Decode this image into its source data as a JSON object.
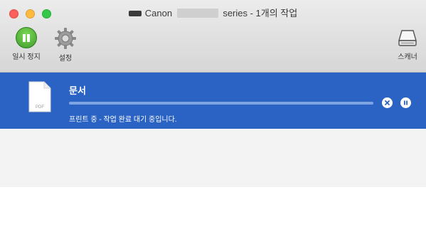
{
  "window": {
    "title_prefix": "Canon",
    "title_suffix": "series - 1개의 작업"
  },
  "toolbar": {
    "pause_label": "일시 정지",
    "settings_label": "설정",
    "scanner_label": "스캐너"
  },
  "job": {
    "name": "문서",
    "thumb_text": "PDF",
    "status": "프린트 중 - 작업 완료 대기 중입니다.",
    "progress": 0.0
  },
  "colors": {
    "selection": "#2a63c4",
    "pause_green": "#3e9a2a"
  },
  "icons": {
    "pause": "pause-icon",
    "settings": "gear-icon",
    "scanner": "scanner-icon",
    "cancel": "cancel-icon",
    "job_pause": "pause-icon",
    "document": "document-icon"
  }
}
